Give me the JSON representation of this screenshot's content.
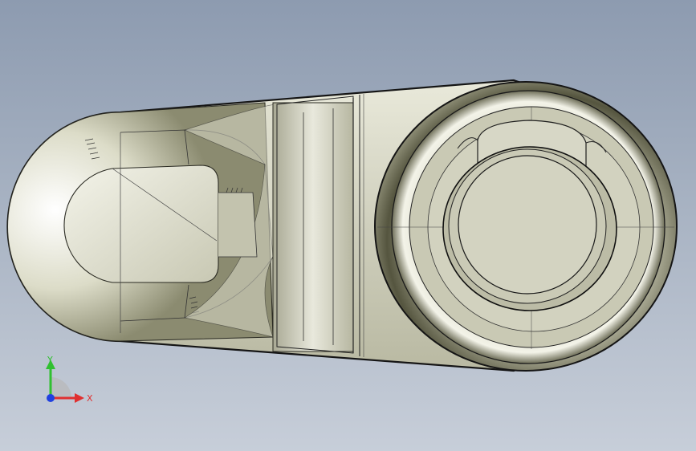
{
  "viewport": {
    "background_top": "#8d9bb0",
    "background_bottom": "#c7ced9"
  },
  "part": {
    "body_color": "#d6d6c4",
    "edge_color": "#1a1a1a",
    "highlight_color": "#f7f7ee",
    "shadow_color": "#6e6e58"
  },
  "triad": {
    "x_label": "X",
    "y_label": "Y",
    "x_color": "#e03030",
    "y_color": "#30c030",
    "z_color": "#2040e0"
  }
}
